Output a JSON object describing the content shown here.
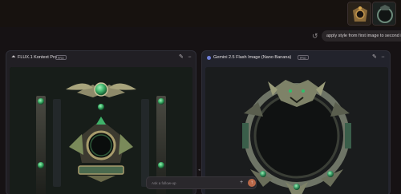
{
  "colors": {
    "background": "#161214",
    "panel": "#23232b",
    "accent_send": "#b86848",
    "gem_green": "#3fb36a",
    "model_dot": "#6f7fd8"
  },
  "header": {
    "thumbnails": [
      "first-image-thumbnail",
      "second-image-thumbnail"
    ]
  },
  "prompt": {
    "text": "apply style from first image to second image",
    "restore_icon": "restore-icon"
  },
  "panels": [
    {
      "icon": "flux-logo-icon",
      "model_name": "FLUX.1 Kontext Pro",
      "badge": "PRO",
      "actions": [
        "edit-icon",
        "more-icon"
      ]
    },
    {
      "icon": "gemini-dot-icon",
      "model_name": "Gemini 2.5 Flash Image (Nano Banana)",
      "badge": "PRO",
      "actions": [
        "edit-icon",
        "more-icon"
      ]
    }
  ],
  "composer": {
    "placeholder": "Ask a follow-up",
    "plus_icon": "plus-icon",
    "send_icon": "send-arrow-icon"
  }
}
